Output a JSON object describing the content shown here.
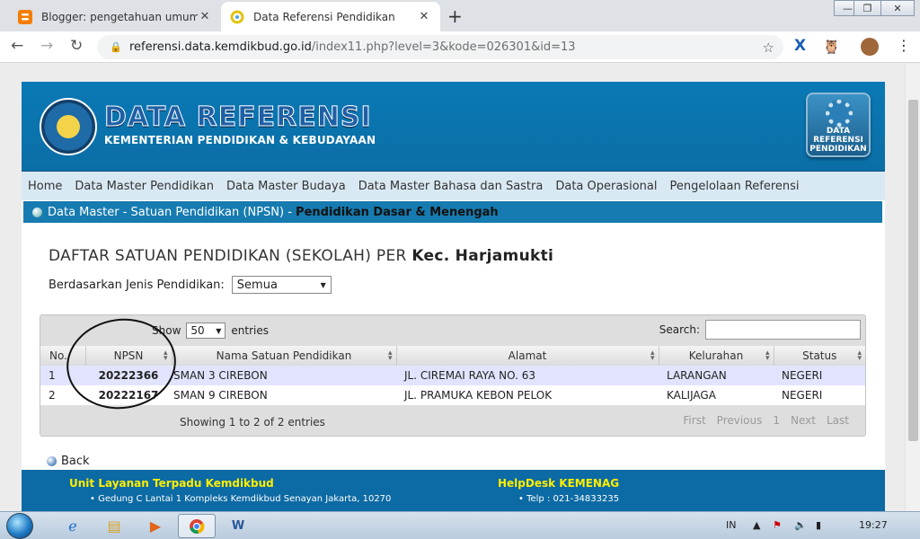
{
  "browser": {
    "tabs": [
      {
        "title": "Blogger: pengetahuan umum - E",
        "active": false
      },
      {
        "title": "Data Referensi Pendidikan",
        "active": true
      }
    ],
    "new_tab_label": "+",
    "url_host": "referensi.data.kemdikbud.go.id",
    "url_path": "/index11.php?level=3&kode=026301&id=13"
  },
  "site": {
    "brand_title": "DATA REFERENSI",
    "brand_subtitle": "KEMENTERIAN PENDIDIKAN & KEBUDAYAAN",
    "badge_line1": "DATA",
    "badge_line2": "REFERENSI",
    "badge_line3": "PENDIDIKAN",
    "menu": [
      "Home",
      "Data Master Pendidikan",
      "Data Master Budaya",
      "Data Master Bahasa dan Sastra",
      "Data Operasional",
      "Pengelolaan Referensi"
    ],
    "breadcrumb_prefix": "Data Master - Satuan Pendidikan (NPSN) - ",
    "breadcrumb_current": "Pendidikan Dasar & Menengah",
    "heading_prefix": "DAFTAR SATUAN PENDIDIKAN (SEKOLAH) PER ",
    "heading_place": "Kec. Harjamukti",
    "filter_label": "Berdasarkan Jenis Pendidikan:",
    "filter_value": "Semua"
  },
  "table": {
    "show_label": "Show",
    "show_value": "50",
    "entries_label": "entries",
    "search_label": "Search:",
    "columns": [
      "No.",
      "NPSN",
      "Nama Satuan Pendidikan",
      "Alamat",
      "Kelurahan",
      "Status"
    ],
    "rows": [
      [
        "1",
        "20222366",
        "SMAN 3 CIREBON",
        "JL. CIREMAI RAYA NO. 63",
        "LARANGAN",
        "NEGERI"
      ],
      [
        "2",
        "20222167",
        "SMAN 9 CIREBON",
        "JL. PRAMUKA KEBON PELOK",
        "KALIJAGA",
        "NEGERI"
      ]
    ],
    "info": "Showing 1 to 2 of 2 entries",
    "pager": [
      "First",
      "Previous",
      "1",
      "Next",
      "Last"
    ]
  },
  "back_label": "Back",
  "footer": {
    "left_title": "Unit Layanan Terpadu Kemdikbud",
    "left_sub": "Gedung C Lantai 1 Kompleks Kemdikbud Senayan Jakarta, 10270",
    "right_title": "HelpDesk KEMENAG",
    "right_sub": "Telp : 021-34833235"
  },
  "taskbar": {
    "lang": "IN",
    "clock": "19:27"
  },
  "colors": {
    "header_blue": "#0a79b5",
    "menu_bg": "#d9e9f4",
    "row_highlight": "#e2e4ff",
    "footer_title": "#ffee00"
  }
}
